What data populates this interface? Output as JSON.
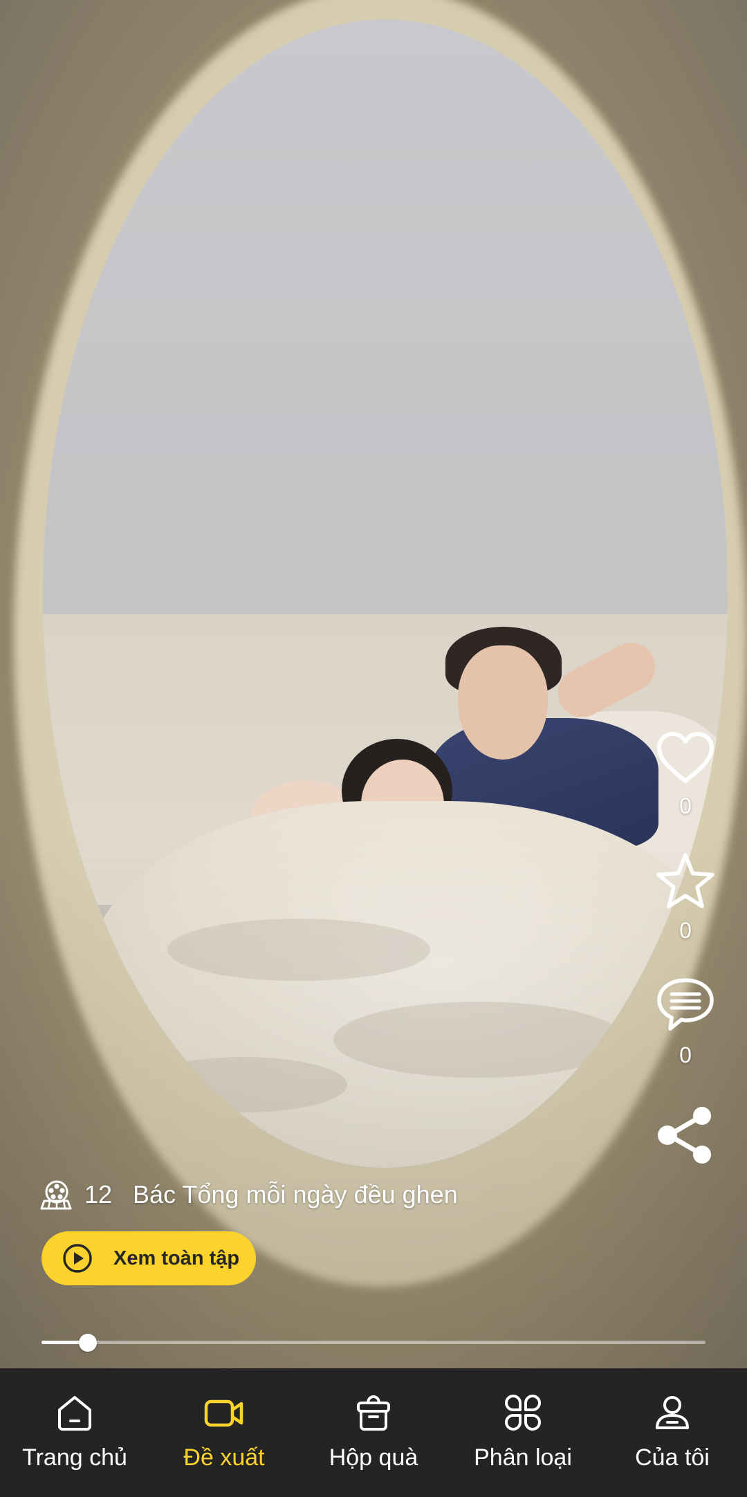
{
  "video": {
    "episode_icon": "film-reel-icon",
    "episode_count": "12",
    "title": "Bác Tổng mỗi ngày đều ghen",
    "watch_button_label": "Xem toàn tập",
    "progress": 0.07
  },
  "actions": {
    "like": {
      "icon": "heart-icon",
      "count": "0"
    },
    "favorite": {
      "icon": "star-icon",
      "count": "0"
    },
    "comment": {
      "icon": "comment-icon",
      "count": "0"
    },
    "share": {
      "icon": "share-icon"
    }
  },
  "bottom_nav": {
    "active": "Đề xuất",
    "items": [
      {
        "label": "Trang chủ",
        "icon": "home-icon"
      },
      {
        "label": "Đề xuất",
        "icon": "video-camera-icon"
      },
      {
        "label": "Hộp quà",
        "icon": "gift-box-icon"
      },
      {
        "label": "Phân loại",
        "icon": "category-grid-icon"
      },
      {
        "label": "Của tôi",
        "icon": "profile-icon"
      }
    ]
  },
  "colors": {
    "accent": "#fbd32c",
    "nav_background": "#242424"
  }
}
